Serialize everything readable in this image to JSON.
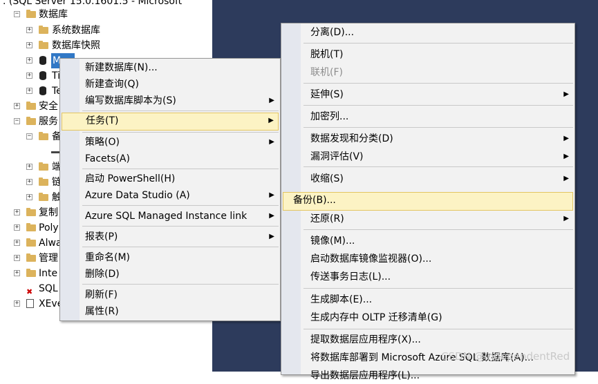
{
  "window": {
    "title_fragment": ". (SQL Server 15.0.1601.5 - Microsoft"
  },
  "tree": {
    "databases": "数据库",
    "system_databases": "系统数据库",
    "snapshots": "数据库快照",
    "db_m": "M",
    "db_t1": "Ti",
    "db_t2": "Te",
    "security": "安全",
    "server_objects": "服务",
    "backup_devices": "备",
    "endpoints": "端",
    "linked_servers": "链",
    "triggers": "触",
    "replication": "复制",
    "polybase": "Poly",
    "alwayson": "Alwa",
    "management": "管理",
    "integration": "Inte",
    "sql_agent": "SQL",
    "xevent": "XEve"
  },
  "context_menu": {
    "items": [
      {
        "label": "新建数据库(N)...",
        "submenu": false
      },
      {
        "label": "新建查询(Q)",
        "submenu": false
      },
      {
        "label": "编写数据库脚本为(S)",
        "submenu": true
      },
      {
        "label": "任务(T)",
        "submenu": true,
        "highlighted": true
      },
      {
        "label": "策略(O)",
        "submenu": true
      },
      {
        "label": "Facets(A)",
        "submenu": false
      },
      {
        "label": "启动 PowerShell(H)",
        "submenu": false
      },
      {
        "label": "Azure Data Studio (A)",
        "submenu": true
      },
      {
        "label": "Azure SQL Managed Instance link",
        "submenu": true
      },
      {
        "label": "报表(P)",
        "submenu": true
      },
      {
        "label": "重命名(M)",
        "submenu": false
      },
      {
        "label": "删除(D)",
        "submenu": false
      },
      {
        "label": "刷新(F)",
        "submenu": false
      },
      {
        "label": "属性(R)",
        "submenu": false
      }
    ],
    "arrow": "▶"
  },
  "tasks_menu": {
    "items": [
      {
        "label": "分离(D)...",
        "submenu": false
      },
      {
        "label": "脱机(T)",
        "submenu": false
      },
      {
        "label": "联机(F)",
        "submenu": false,
        "disabled": true
      },
      {
        "label": "延伸(S)",
        "submenu": true
      },
      {
        "label": "加密列...",
        "submenu": false
      },
      {
        "label": "数据发现和分类(D)",
        "submenu": true
      },
      {
        "label": "漏洞评估(V)",
        "submenu": true
      },
      {
        "label": "收缩(S)",
        "submenu": true
      },
      {
        "label": "备份(B)...",
        "submenu": false,
        "highlighted": true
      },
      {
        "label": "还原(R)",
        "submenu": true
      },
      {
        "label": "镜像(M)...",
        "submenu": false
      },
      {
        "label": "启动数据库镜像监视器(O)...",
        "submenu": false
      },
      {
        "label": "传送事务日志(L)...",
        "submenu": false
      },
      {
        "label": "生成脚本(E)...",
        "submenu": false
      },
      {
        "label": "生成内存中 OLTP 迁移清单(G)",
        "submenu": false
      },
      {
        "label": "提取数据层应用程序(X)...",
        "submenu": false
      },
      {
        "label": "将数据库部署到 Microsoft Azure SQL 数据库(A)...",
        "submenu": false
      },
      {
        "label": "导出数据层应用程序(L)...",
        "submenu": false
      }
    ]
  },
  "watermark": "CSDN @IndependentRed"
}
